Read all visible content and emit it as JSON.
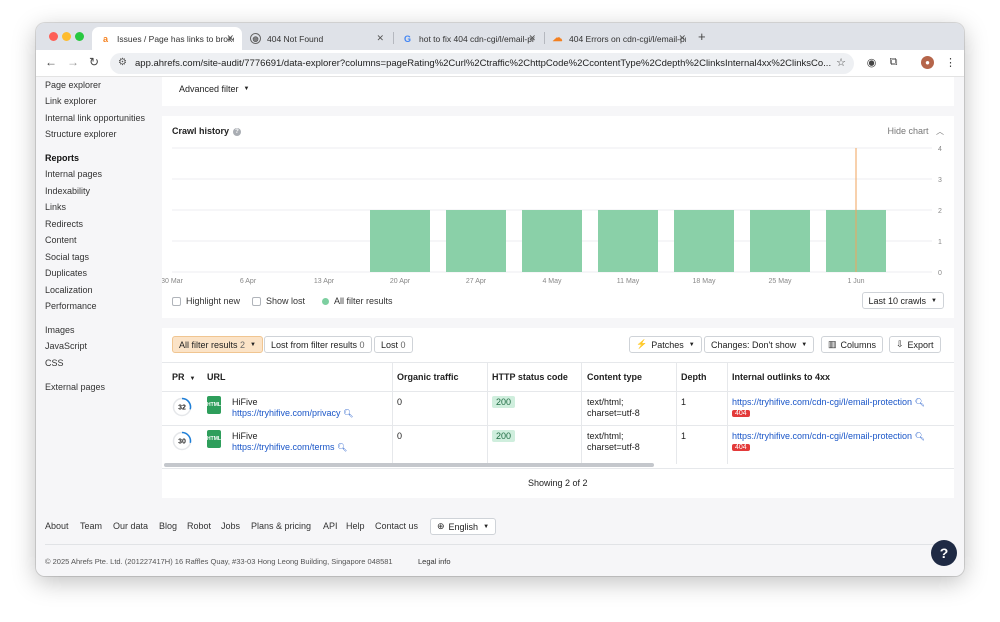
{
  "browser": {
    "tabs": [
      {
        "title": "Issues / Page has links to broken",
        "favicon": "ahrefs-icon"
      },
      {
        "title": "404 Not Found",
        "favicon": "globe-icon"
      },
      {
        "title": "hot to fix 404 cdn-cgi/l/email-pr",
        "favicon": "google-icon"
      },
      {
        "title": "404 Errors on cdn-cgi/l/email-prot",
        "favicon": "cloudflare-icon"
      }
    ],
    "url": "app.ahrefs.com/site-audit/7776691/data-explorer?columns=pageRating%2Curl%2Ctraffic%2ChttpCode%2CcontentType%2Cdepth%2ClinksInternal4xx%2ClinksCo..."
  },
  "sidebar": {
    "items_top": [
      "Page explorer",
      "Link explorer",
      "Internal link opportunities",
      "Structure explorer"
    ],
    "reports_heading": "Reports",
    "reports": [
      "Internal pages",
      "Indexability",
      "Links",
      "Redirects",
      "Content",
      "Social tags",
      "Duplicates",
      "Localization",
      "Performance"
    ],
    "other": [
      "Images",
      "JavaScript",
      "CSS"
    ],
    "external": "External pages"
  },
  "filters": {
    "advanced_filter": "Advanced filter"
  },
  "chart_panel": {
    "title": "Crawl history",
    "hide_chart": "Hide chart",
    "highlight_new": "Highlight new",
    "show_lost": "Show lost",
    "legend_all": "All filter results",
    "last_crawls": "Last 10 crawls"
  },
  "chart_data": {
    "type": "bar",
    "categories": [
      "30 Mar",
      "6 Apr",
      "13 Apr",
      "20 Apr",
      "27 Apr",
      "4 May",
      "11 May",
      "18 May",
      "25 May",
      "1 Jun"
    ],
    "series": [
      {
        "name": "All filter results",
        "values": [
          0,
          0,
          0,
          2,
          2,
          2,
          2,
          2,
          2,
          2
        ]
      }
    ],
    "yticks": [
      "4",
      "3",
      "2",
      "1",
      "0"
    ],
    "ylim": [
      0,
      4
    ],
    "grid": true,
    "colors": {
      "bar": "#8ad0a8",
      "marker": "#f0a35b"
    }
  },
  "results": {
    "tab_all": "All filter results",
    "tab_all_count": "2",
    "tab_lost_from": "Lost from filter results",
    "tab_lost_from_count": "0",
    "tab_lost": "Lost",
    "tab_lost_count": "0",
    "patches": "Patches",
    "changes": "Changes: Don't show",
    "columns": "Columns",
    "export": "Export",
    "headers": [
      "PR",
      "URL",
      "Organic traffic",
      "HTTP status code",
      "Content type",
      "Depth",
      "Internal outlinks to 4xx"
    ],
    "rows": [
      {
        "pr": "32",
        "title": "HiFive",
        "url": "https://tryhifive.com/privacy",
        "traffic": "0",
        "status": "200",
        "ctype1": "text/html;",
        "ctype2": "charset=utf-8",
        "depth": "1",
        "outlink": "https://tryhifive.com/cdn-cgi/l/email-protection",
        "outlink_code": "404"
      },
      {
        "pr": "30",
        "title": "HiFive",
        "url": "https://tryhifive.com/terms",
        "traffic": "0",
        "status": "200",
        "ctype1": "text/html;",
        "ctype2": "charset=utf-8",
        "depth": "1",
        "outlink": "https://tryhifive.com/cdn-cgi/l/email-protection",
        "outlink_code": "404"
      }
    ],
    "showing": "Showing 2 of 2"
  },
  "footer": {
    "links": [
      "About",
      "Team",
      "Our data",
      "Blog",
      "Robot",
      "Jobs",
      "Plans & pricing",
      "API",
      "Help",
      "Contact us"
    ],
    "language": "English",
    "copyright": "© 2025 Ahrefs Pte. Ltd. (201227417H) 16 Raffles Quay, #33-03 Hong Leong Building, Singapore 048581",
    "legal": "Legal info",
    "help_button": "?"
  }
}
